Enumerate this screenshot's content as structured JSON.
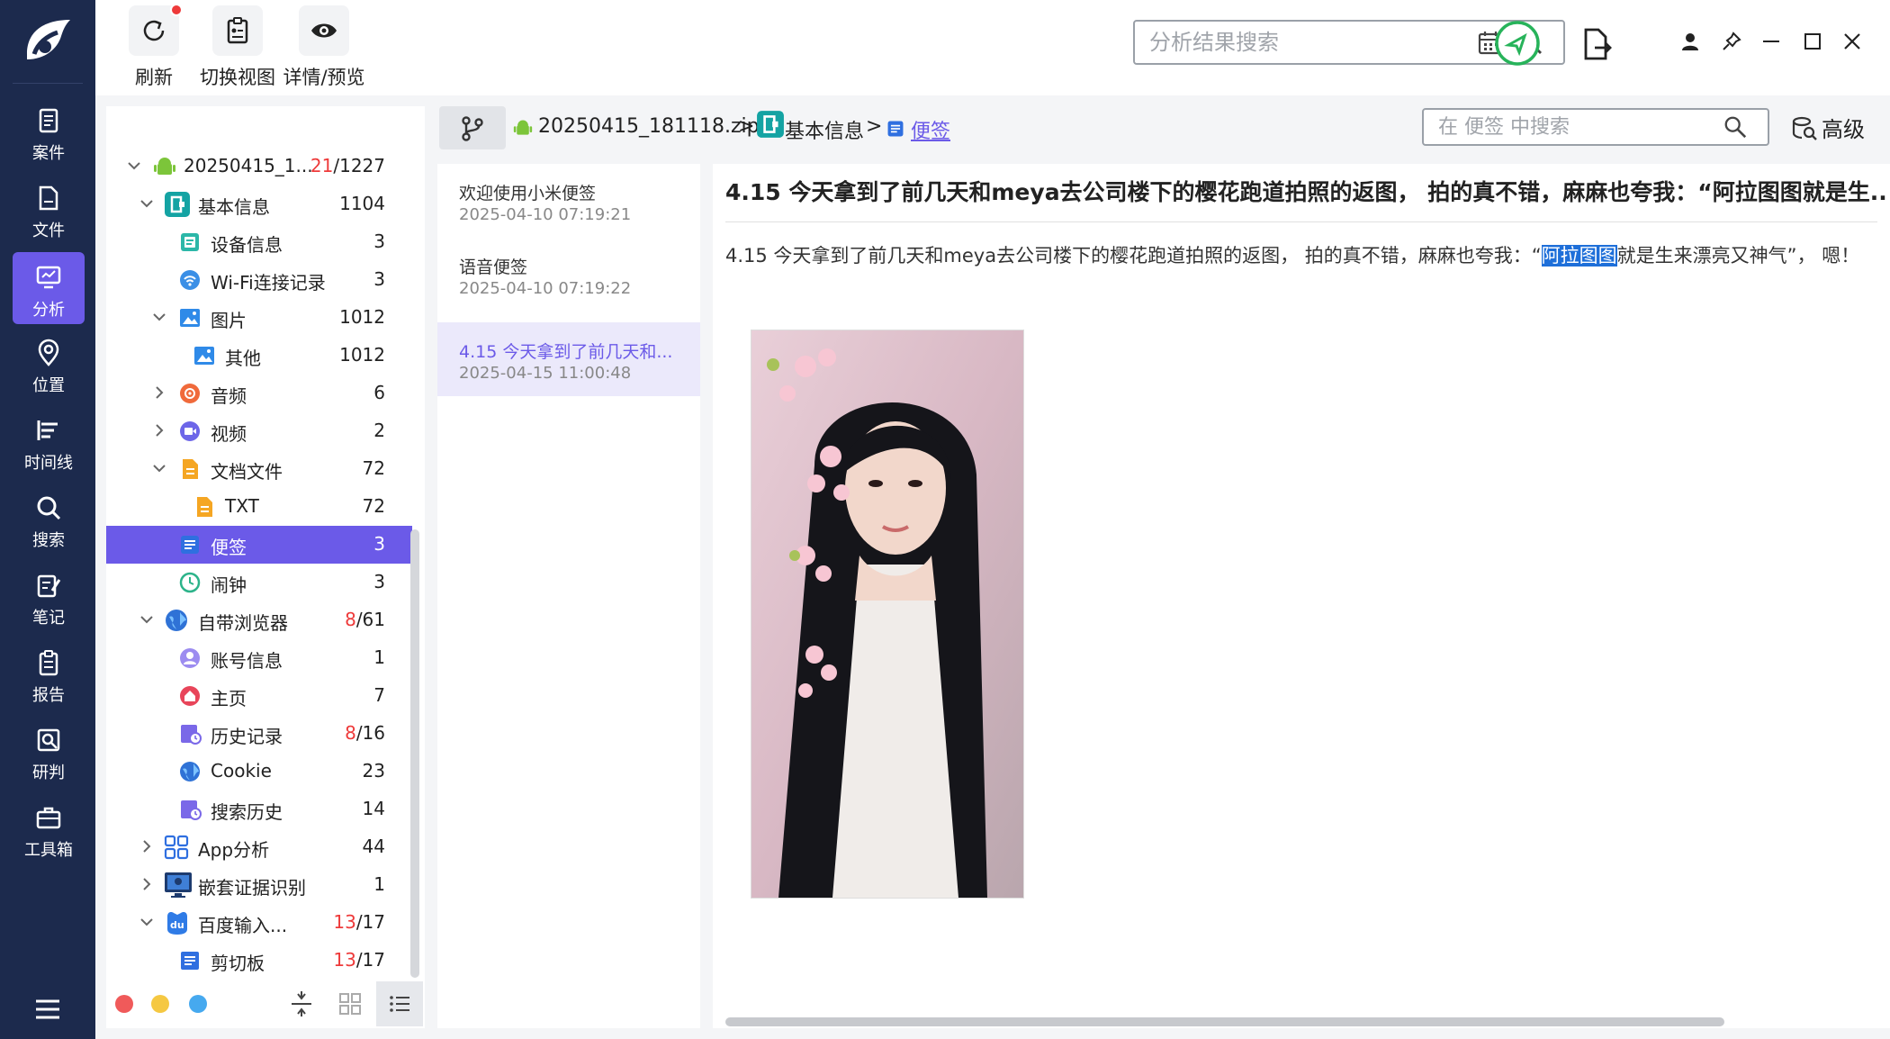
{
  "nav": {
    "items": [
      {
        "label": "案件",
        "icon": "case-icon"
      },
      {
        "label": "文件",
        "icon": "file-icon"
      },
      {
        "label": "分析",
        "icon": "analysis-icon",
        "active": true
      },
      {
        "label": "位置",
        "icon": "location-pin-icon"
      },
      {
        "label": "时间线",
        "icon": "timeline-icon"
      },
      {
        "label": "搜索",
        "icon": "search-icon"
      },
      {
        "label": "笔记",
        "icon": "note-icon"
      },
      {
        "label": "报告",
        "icon": "report-icon"
      },
      {
        "label": "研判",
        "icon": "judge-icon"
      },
      {
        "label": "工具箱",
        "icon": "toolbox-icon"
      }
    ]
  },
  "toolbar": {
    "refresh_label": "刷新",
    "switch_view_label": "切换视图",
    "preview_label": "详情/预览"
  },
  "search": {
    "main_placeholder": "分析结果搜索",
    "sub_placeholder": "在 便签 中搜索",
    "advanced_label": "高级"
  },
  "tree": {
    "root": {
      "label": "20250415_1...",
      "count_red": "21",
      "count_total": "/1227"
    },
    "rows": [
      {
        "label": "基本信息",
        "count": "1104"
      },
      {
        "label": "设备信息",
        "count": "3"
      },
      {
        "label": "Wi-Fi连接记录",
        "count": "3"
      },
      {
        "label": "图片",
        "count": "1012"
      },
      {
        "label": "其他",
        "count": "1012"
      },
      {
        "label": "音频",
        "count": "6"
      },
      {
        "label": "视频",
        "count": "2"
      },
      {
        "label": "文档文件",
        "count": "72"
      },
      {
        "label": "TXT",
        "count": "72"
      },
      {
        "label": "便签",
        "count": "3"
      },
      {
        "label": "闹钟",
        "count": "3"
      },
      {
        "label": "自带浏览器",
        "count_red": "8",
        "count_total": "/61"
      },
      {
        "label": "账号信息",
        "count": "1"
      },
      {
        "label": "主页",
        "count": "7"
      },
      {
        "label": "历史记录",
        "count_red": "8",
        "count_total": "/16"
      },
      {
        "label": "Cookie",
        "count": "23"
      },
      {
        "label": "搜索历史",
        "count": "14"
      },
      {
        "label": "App分析",
        "count": "44"
      },
      {
        "label": "嵌套证据识别",
        "count": "1"
      },
      {
        "label": "百度输入...",
        "count_red": "13",
        "count_total": "/17"
      },
      {
        "label": "剪切板",
        "count_red": "13",
        "count_total": "/17"
      }
    ]
  },
  "breadcrumb": {
    "zip": "20250415_181118.zip",
    "basic": "基本信息",
    "current": "便签",
    "sep": ">"
  },
  "notes": [
    {
      "title": "欢迎使用小米便签",
      "date": "2025-04-10 07:19:21"
    },
    {
      "title": "语音便签",
      "date": "2025-04-10 07:19:22"
    },
    {
      "title": "4.15 今天拿到了前几天和...",
      "date": "2025-04-15 11:00:48"
    }
  ],
  "detail": {
    "title": "4.15 今天拿到了前几天和meya去公司楼下的樱花跑道拍照的返图， 拍的真不错，麻麻也夸我：“阿拉图图就是生...",
    "body_before": "4.15  今天拿到了前几天和meya去公司楼下的樱花跑道拍照的返图， 拍的真不错，麻麻也夸我：“",
    "body_highlight": "阿拉图图",
    "body_after": "就是生来漂亮又神气”， 嗯！",
    "photo_alt": "photo"
  },
  "colors": {
    "accent": "#6b5ae8",
    "nav_bg": "#1c2a4d",
    "count_red": "#ee3a3a",
    "highlight": "#1e6fd9"
  }
}
